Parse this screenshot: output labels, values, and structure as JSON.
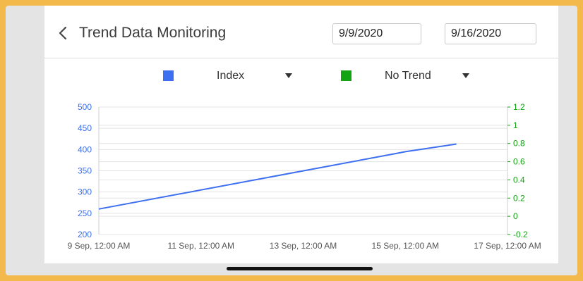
{
  "header": {
    "title": "Trend Data Monitoring",
    "start_date": "9/9/2020",
    "end_date": "9/16/2020"
  },
  "legend": [
    {
      "label": "Index",
      "color": "#3d6ff0"
    },
    {
      "label": "No Trend",
      "color": "#13a313"
    }
  ],
  "chart_data": {
    "type": "line",
    "x_ticks": [
      "9 Sep, 12:00 AM",
      "11 Sep, 12:00 AM",
      "13 Sep, 12:00 AM",
      "15 Sep, 12:00 AM",
      "17 Sep, 12:00 AM"
    ],
    "y_left_ticks": [
      "500",
      "450",
      "400",
      "350",
      "300",
      "250",
      "200"
    ],
    "y_right_ticks": [
      "1.2",
      "1",
      "0.8",
      "0.6",
      "0.4",
      "0.2",
      "0",
      "-0.2"
    ],
    "y_left_lim": [
      200,
      500
    ],
    "y_right_lim": [
      -0.2,
      1.2
    ],
    "grid": true,
    "series": [
      {
        "name": "Index",
        "axis": "left",
        "color": "#3d6ff0",
        "x": [
          "2020-09-09",
          "2020-09-14T20:00",
          "2020-09-15",
          "2020-09-16"
        ],
        "y": [
          260,
          391,
          395,
          413
        ]
      }
    ]
  }
}
